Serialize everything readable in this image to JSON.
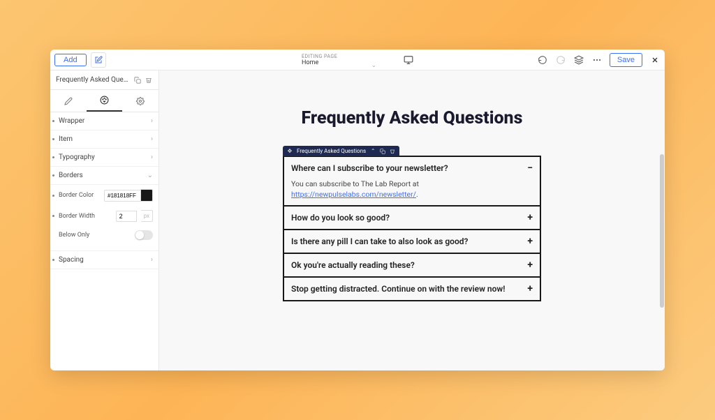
{
  "toolbar": {
    "add_label": "Add",
    "save_label": "Save",
    "page_label": "EDITING PAGE",
    "page_value": "Home"
  },
  "sidebar": {
    "selected_block": "Frequently Asked Quest...",
    "sections": {
      "wrapper": "Wrapper",
      "item": "Item",
      "typography": "Typography",
      "borders": "Borders",
      "spacing": "Spacing"
    },
    "fields": {
      "border_color_label": "Border Color",
      "border_color_value": "#181818FF",
      "border_color_swatch": "#181818",
      "border_width_label": "Border Width",
      "border_width_value": "2",
      "border_width_unit": "px",
      "below_only_label": "Below Only"
    }
  },
  "block_toolbar_label": "Frequently Asked Questions",
  "faq": {
    "title": "Frequently Asked Questions",
    "items": [
      {
        "q": "Where can I subscribe to your newsletter?",
        "expanded": true,
        "answer_prefix": "You can subscribe to The Lab Report at ",
        "answer_link": "https://newpulselabs.com/newsletter/",
        "answer_suffix": "."
      },
      {
        "q": "How do you look so good?",
        "expanded": false
      },
      {
        "q": "Is there any pill I can take to also look as good?",
        "expanded": false
      },
      {
        "q": "Ok you're actually reading these?",
        "expanded": false
      },
      {
        "q": "Stop getting distracted. Continue on with the review now!",
        "expanded": false
      }
    ]
  }
}
